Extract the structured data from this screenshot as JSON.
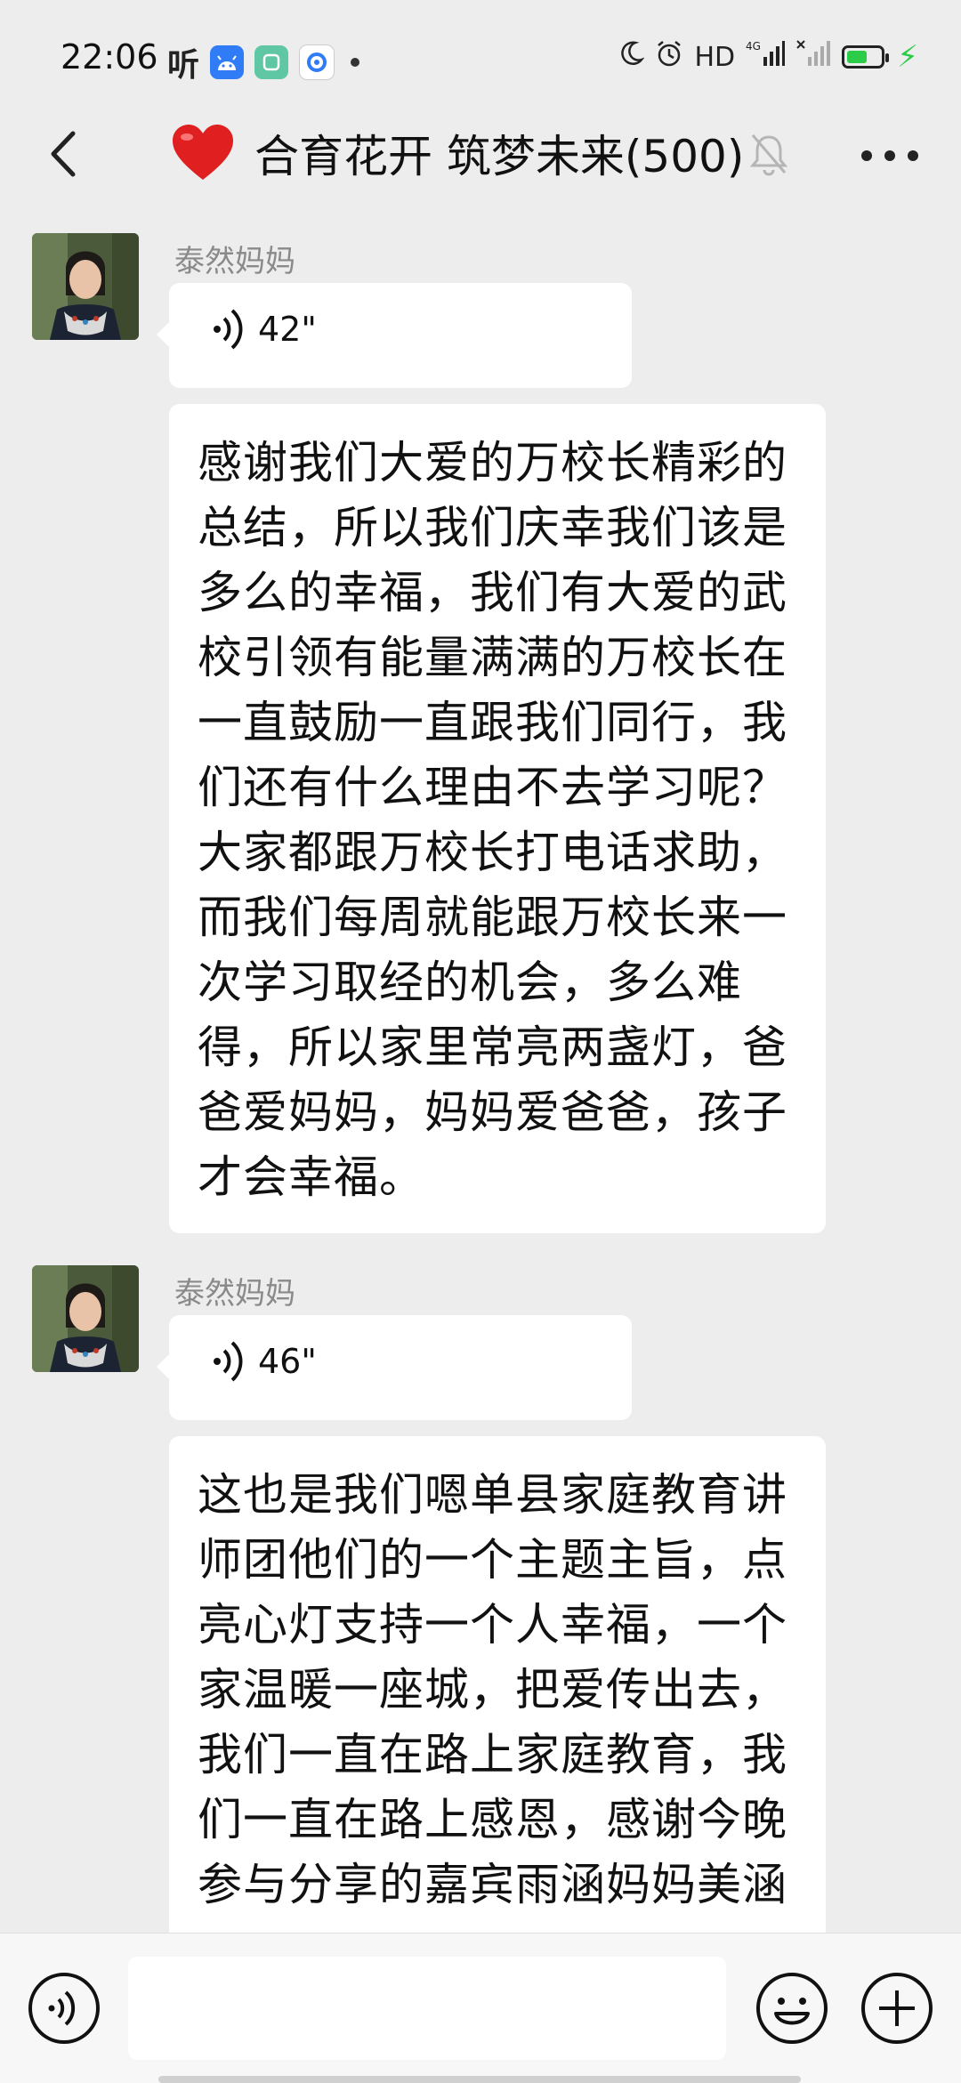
{
  "status_bar": {
    "time": "22:06",
    "left_icons": [
      "ting-icon",
      "android-app-icon",
      "green-app-icon",
      "blue-circle-app-icon",
      "dot-icon"
    ],
    "ting_label": "听",
    "hd_label": "HD",
    "network_label": "4G",
    "battery_level": 0.6,
    "colors": {
      "battery": "#2bcc48"
    }
  },
  "header": {
    "title": "合育花开 筑梦未来(500)",
    "icons": [
      "back-icon",
      "heart-icon",
      "mute-bell-icon",
      "more-icon"
    ],
    "heart_color": "#e02020"
  },
  "messages": [
    {
      "sender": "泰然妈妈",
      "voice_duration": "42\"",
      "text": "感谢我们大爱的万校长精彩的总结，所以我们庆幸我们该是多么的幸福，我们有大爱的武校引领有能量满满的万校长在一直鼓励一直跟我们同行，我们还有什么理由不去学习呢？大家都跟万校长打电话求助，而我们每周就能跟万校长来一次学习取经的机会，多么难得，所以家里常亮两盏灯，爸爸爱妈妈，妈妈爱爸爸，孩子才会幸福。"
    },
    {
      "sender": "泰然妈妈",
      "voice_duration": "46\"",
      "text": "这也是我们嗯单县家庭教育讲师团他们的一个主题主旨，点亮心灯支持一个人幸福，一个家温暖一座城，把爱传出去，我们一直在路上家庭教育，我们一直在路上感恩，感谢今晚参与分享的嘉宾雨涵妈妈美涵"
    }
  ],
  "input_bar": {
    "placeholder": "",
    "icons": [
      "voice-toggle-icon",
      "emoji-icon",
      "plus-icon"
    ]
  }
}
